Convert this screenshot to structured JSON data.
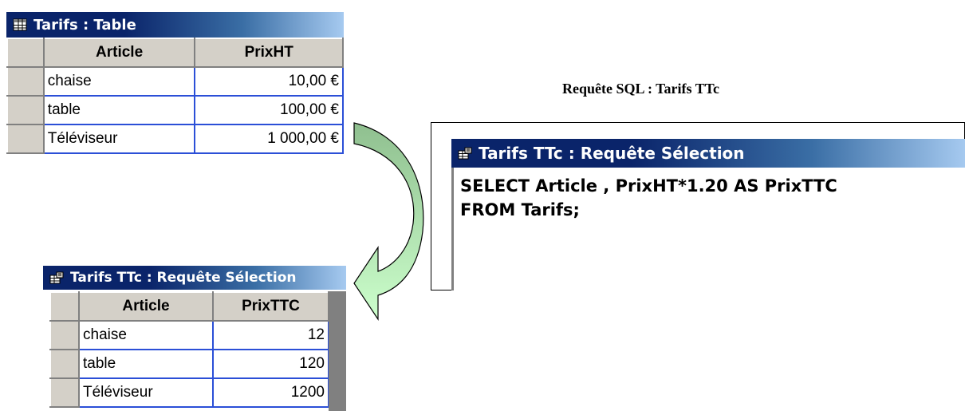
{
  "source_table": {
    "title": "Tarifs : Table",
    "icon": "table-icon",
    "columns": [
      "Article",
      "PrixHT"
    ],
    "rows": [
      [
        "chaise",
        "10,00 €"
      ],
      [
        "table",
        "100,00 €"
      ],
      [
        "Téléviseur",
        "1 000,00 €"
      ]
    ]
  },
  "result_table": {
    "title": "Tarifs TTc : Requête Sélection",
    "icon": "query-icon",
    "columns": [
      "Article",
      "PrixTTC"
    ],
    "rows": [
      [
        "chaise",
        "12"
      ],
      [
        "table",
        "120"
      ],
      [
        "Téléviseur",
        "1200"
      ]
    ]
  },
  "sql_panel": {
    "caption": "Requête SQL : Tarifs TTc",
    "title": "Tarifs TTc : Requête Sélection",
    "icon": "query-icon",
    "lines": [
      "SELECT Article , PrixHT*1.20 AS PrixTTC",
      "FROM Tarifs;"
    ]
  },
  "colors": {
    "titlebar": "#0a246a",
    "grid_lines": "#2b4fd7",
    "arrow_fill_top": "#8fbf8f",
    "arrow_fill_bottom": "#ccffcc"
  }
}
